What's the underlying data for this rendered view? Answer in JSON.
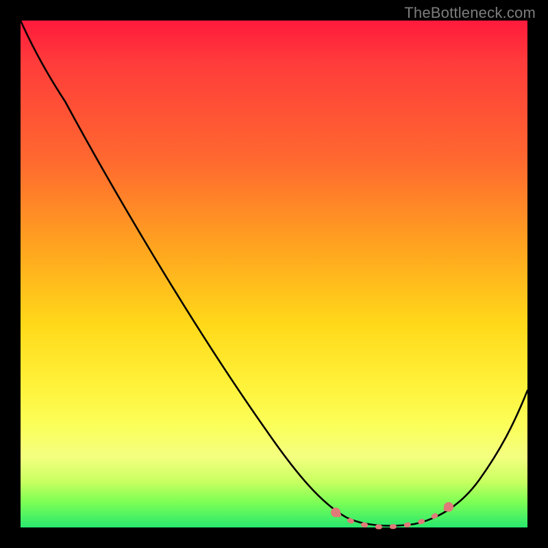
{
  "watermark": "TheBottleneck.com",
  "chart_data": {
    "type": "line",
    "title": "",
    "subtitle": "",
    "xlabel": "",
    "ylabel": "",
    "xlim": [
      0,
      100
    ],
    "ylim": [
      0,
      100
    ],
    "grid": false,
    "legend": false,
    "x": [
      0,
      5,
      10,
      20,
      30,
      40,
      50,
      58,
      62,
      66,
      70,
      74,
      78,
      82,
      86,
      90,
      95,
      100
    ],
    "values": [
      100,
      94,
      88,
      74,
      60,
      46,
      32,
      19,
      12,
      6,
      2,
      0,
      0,
      1,
      4,
      10,
      18,
      28
    ],
    "dotted_span_x": [
      62,
      82
    ],
    "annotations": []
  },
  "colors": {
    "curve": "#000000",
    "dots": "#e07a78",
    "background_top": "#ff1a3c",
    "background_mid": "#fff23a",
    "background_bottom": "#28e86e",
    "frame": "#000000",
    "watermark": "#7e7d7d"
  }
}
